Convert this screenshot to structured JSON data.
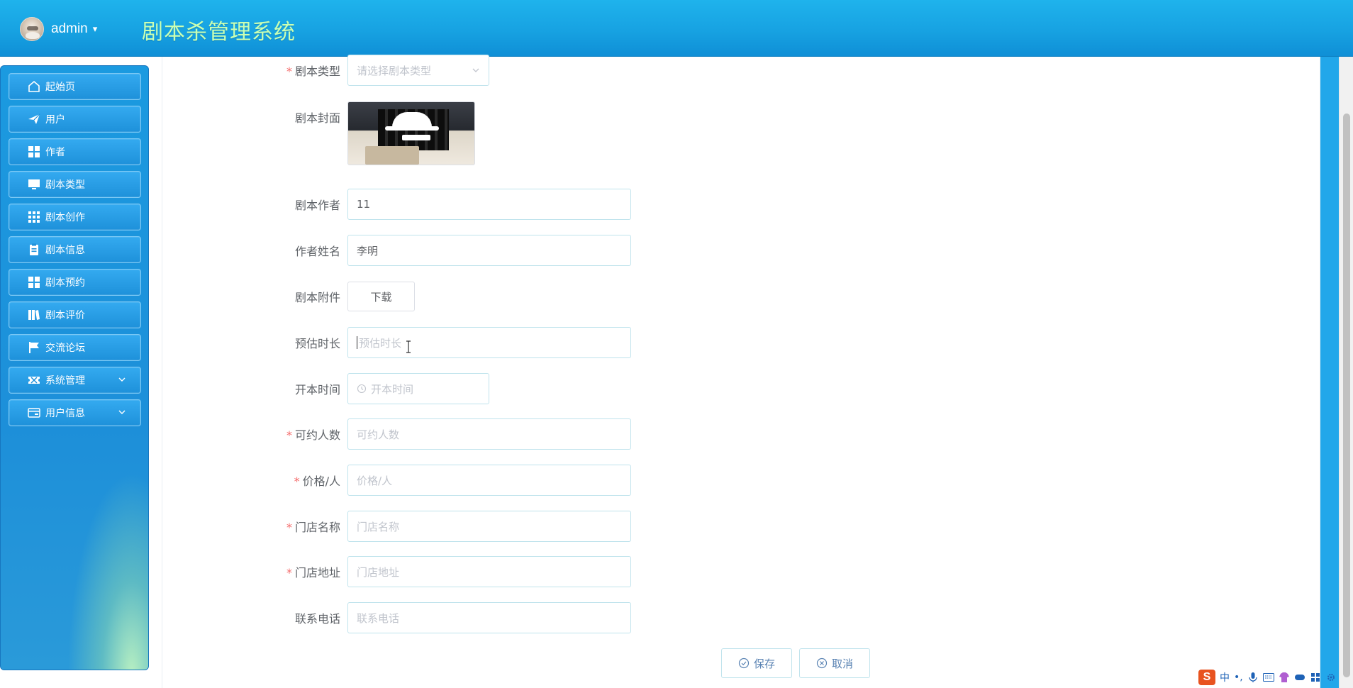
{
  "header": {
    "user_name": "admin",
    "caret": "▾",
    "app_title": "剧本杀管理系统"
  },
  "sidebar": {
    "items": [
      {
        "label": "起始页",
        "icon": "home-icon"
      },
      {
        "label": "用户",
        "icon": "paper-plane-icon"
      },
      {
        "label": "作者",
        "icon": "grid-icon"
      },
      {
        "label": "剧本类型",
        "icon": "monitor-icon"
      },
      {
        "label": "剧本创作",
        "icon": "apps-grid-icon"
      },
      {
        "label": "剧本信息",
        "icon": "clipboard-icon"
      },
      {
        "label": "剧本预约",
        "icon": "grid-icon"
      },
      {
        "label": "剧本评价",
        "icon": "book-icon"
      },
      {
        "label": "交流论坛",
        "icon": "flag-icon"
      },
      {
        "label": "系统管理",
        "icon": "ticket-icon",
        "expandable": true
      },
      {
        "label": "用户信息",
        "icon": "card-icon",
        "expandable": true
      }
    ]
  },
  "form": {
    "script_type": {
      "label": "剧本类型",
      "placeholder": "请选择剧本类型"
    },
    "cover": {
      "label": "剧本封面"
    },
    "author": {
      "label": "剧本作者",
      "value": "11"
    },
    "author_name": {
      "label": "作者姓名",
      "value": "李明"
    },
    "attachment": {
      "label": "剧本附件",
      "button": "下载"
    },
    "duration": {
      "label": "预估时长",
      "placeholder": "预估时长"
    },
    "start_time": {
      "label": "开本时间",
      "placeholder": "开本时间"
    },
    "capacity": {
      "label": "可约人数",
      "placeholder": "可约人数"
    },
    "price": {
      "label": "价格/人",
      "placeholder": "价格/人"
    },
    "store_name": {
      "label": "门店名称",
      "placeholder": "门店名称"
    },
    "store_address": {
      "label": "门店地址",
      "placeholder": "门店地址"
    },
    "phone": {
      "label": "联系电话",
      "placeholder": "联系电话"
    },
    "required_mark": "*"
  },
  "actions": {
    "save": "保存",
    "cancel": "取消"
  },
  "ime": {
    "logo": "S",
    "lang": "中",
    "punct": "•,"
  },
  "colors": {
    "header": "#17a2e2",
    "title": "#c9ffb4",
    "required": "#f56c6c",
    "border": "#bfe3ec"
  }
}
